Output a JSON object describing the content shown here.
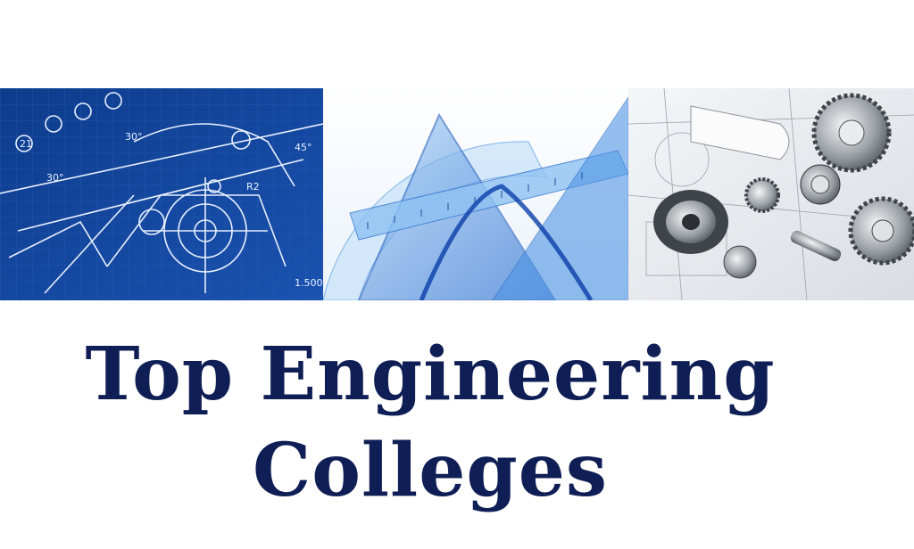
{
  "headline": {
    "line1": "Top Engineering",
    "line2": "Colleges"
  },
  "images": [
    {
      "name": "blueprint-drawing",
      "label": "blueprint technical drawing"
    },
    {
      "name": "drafting-rulers",
      "label": "transparent drafting triangles and protractor"
    },
    {
      "name": "machine-parts",
      "label": "gears and bearings on engineering drawings"
    }
  ],
  "colors": {
    "headline": "#0f1f55",
    "blueprint": "#12449a",
    "ruler": "#3f8fe0"
  }
}
